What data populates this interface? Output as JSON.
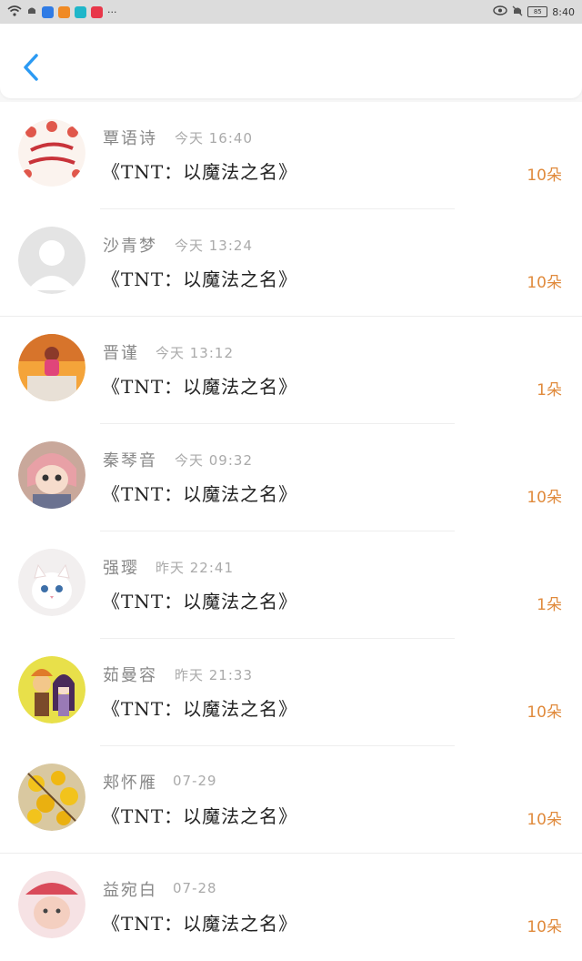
{
  "status_bar": {
    "time": "8:40",
    "left_icons": [
      "wifi-icon",
      "notification-icon",
      "app-blue-icon",
      "app-orange-icon",
      "app-teal-icon",
      "app-red-icon",
      "more-icon"
    ],
    "right_icons": [
      "eye-icon",
      "mute-icon",
      "battery-icon"
    ],
    "battery_label": "85"
  },
  "header": {
    "back_label": "back"
  },
  "items": [
    {
      "name": "覃语诗",
      "time": "今天 16:40",
      "title": "《TNT：以魔法之名》",
      "count": "10朵"
    },
    {
      "name": "沙青梦",
      "time": "今天 13:24",
      "title": "《TNT：以魔法之名》",
      "count": "10朵"
    },
    {
      "name": "晋谨",
      "time": "今天 13:12",
      "title": "《TNT：以魔法之名》",
      "count": "1朵"
    },
    {
      "name": "秦琴音",
      "time": "今天 09:32",
      "title": "《TNT：以魔法之名》",
      "count": "10朵"
    },
    {
      "name": "强璎",
      "time": "昨天 22:41",
      "title": "《TNT：以魔法之名》",
      "count": "1朵"
    },
    {
      "name": "茹曼容",
      "time": "昨天 21:33",
      "title": "《TNT：以魔法之名》",
      "count": "10朵"
    },
    {
      "name": "郏怀雁",
      "time": "07-29",
      "title": "《TNT：以魔法之名》",
      "count": "10朵"
    },
    {
      "name": "益宛白",
      "time": "07-28",
      "title": "《TNT：以魔法之名》",
      "count": "10朵"
    }
  ],
  "colors": {
    "accent": "#2b9af3",
    "count": "#e08a3c"
  }
}
